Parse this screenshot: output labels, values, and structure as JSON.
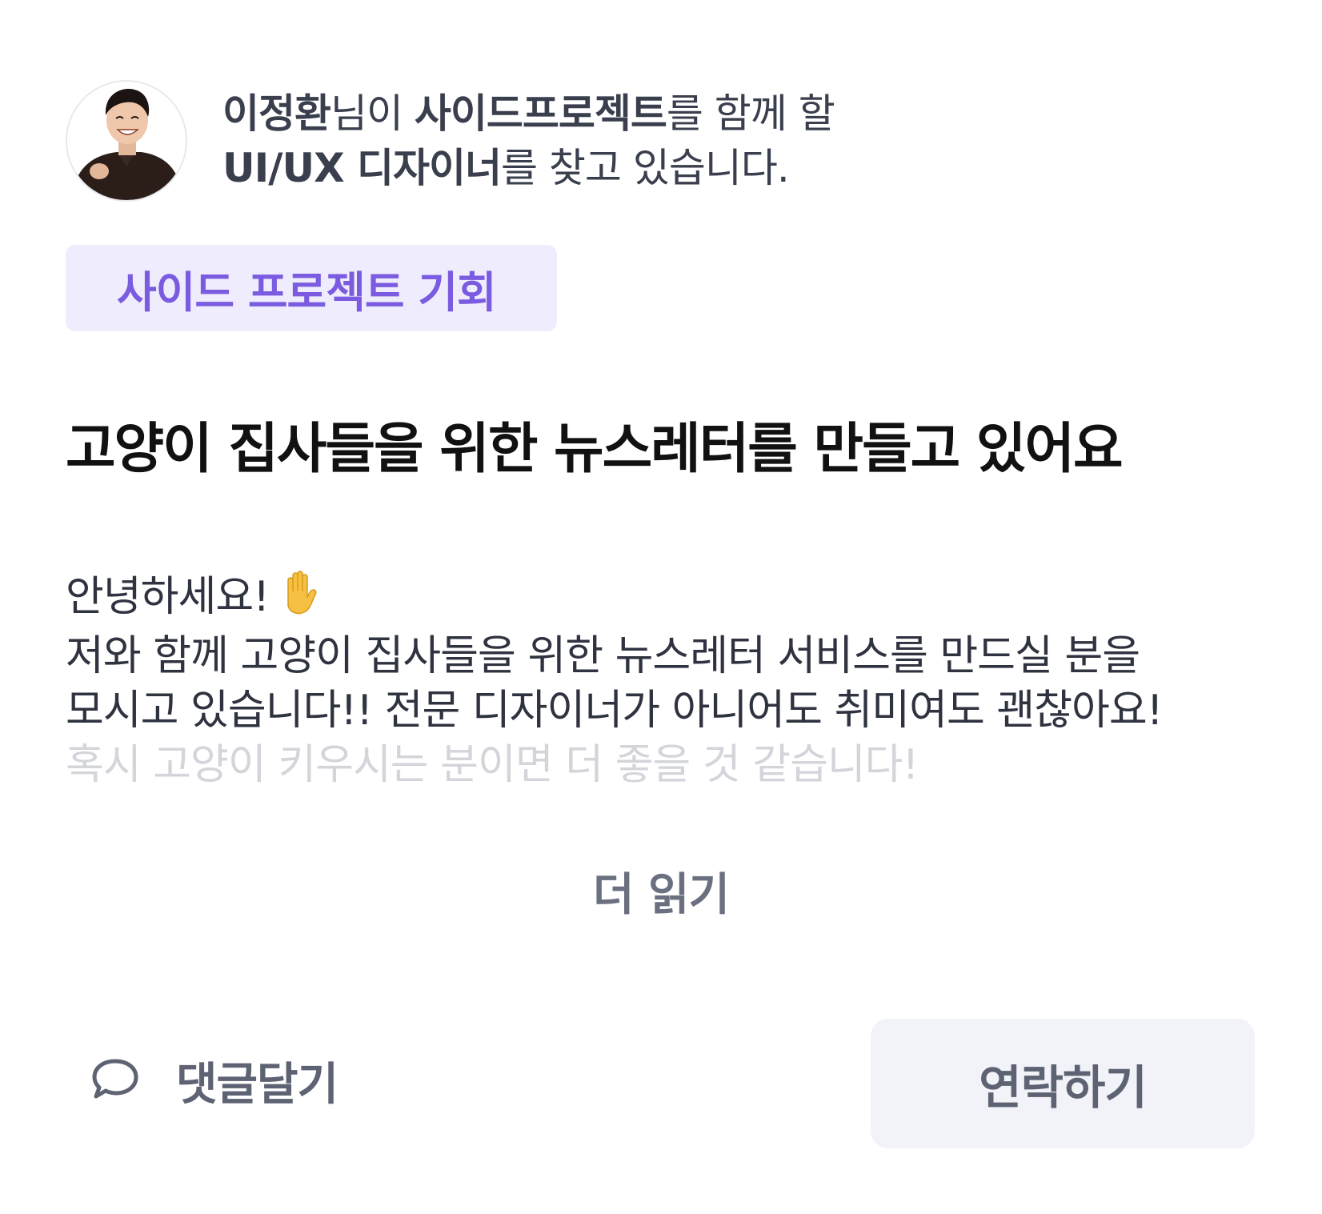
{
  "header": {
    "user_name": "이정환",
    "text_1": "님이 ",
    "category": "사이드프로젝트",
    "text_2": "를 함께 할",
    "role": "UI/UX 디자이너",
    "text_3": "를 찾고 있습니다."
  },
  "badge": {
    "label": "사이드 프로젝트 기회"
  },
  "post": {
    "title": "고양이 집사들을 위한 뉴스레터를 만들고 있어요",
    "greeting": "안녕하세요!",
    "greeting_icon": "raised-hand-icon",
    "line_2": "저와 함께 고양이 집사들을 위한 뉴스레터 서비스를 만드실 분을",
    "line_3": "모시고 있습니다!! 전문 디자이너가 아니어도 취미여도 괜찮아요!",
    "line_4": "혹시 고양이 키우시는 분이면 더 좋을 것 같습니다!"
  },
  "actions": {
    "read_more": "더 읽기",
    "comment": "댓글달기",
    "contact": "연락하기"
  },
  "colors": {
    "accent": "#7b5ce0",
    "badge_bg": "#efedfd",
    "button_bg": "#f1f3f8",
    "muted_text": "#5e6373"
  }
}
